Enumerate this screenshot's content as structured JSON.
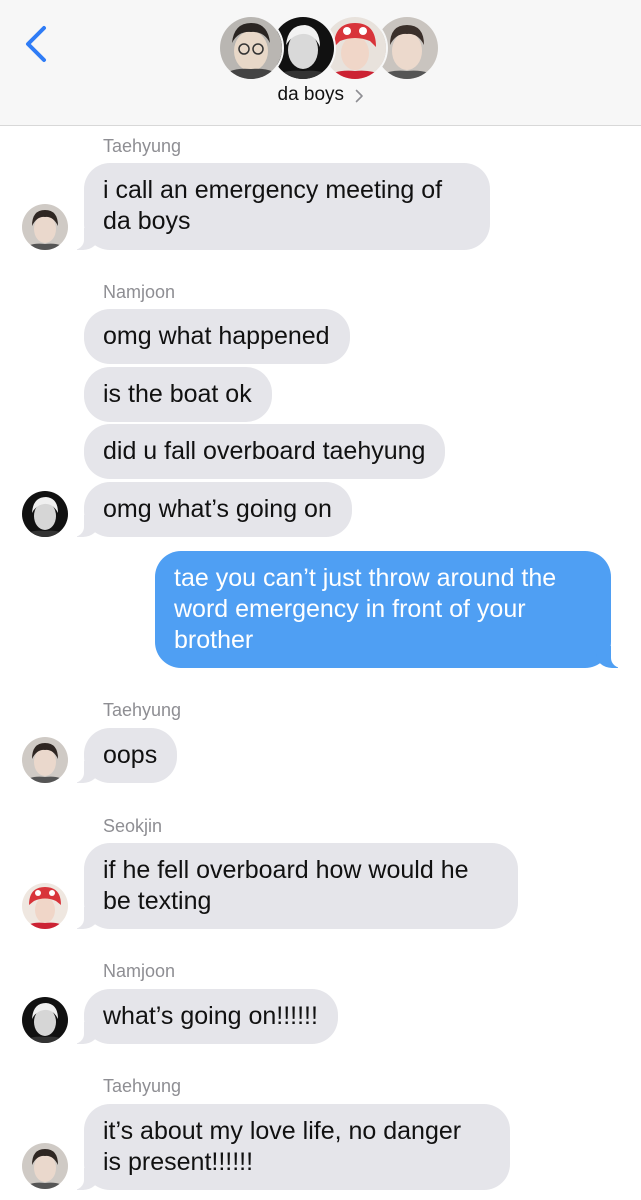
{
  "header": {
    "group_name": "da boys",
    "members": [
      "tae-photo",
      "joon-photo",
      "jin-photo",
      "jk-photo"
    ]
  },
  "messages": [
    {
      "sender": "Taehyung",
      "text_lines": [
        "i call an emergency meeting of",
        "da boys"
      ]
    },
    {
      "sender": "Namjoon",
      "texts": [
        "omg what happened",
        "is the boat ok",
        "did u fall overboard taehyung",
        "omg what’s going on"
      ]
    },
    {
      "sent_lines": [
        "tae you can’t just throw around the",
        "word emergency in front of your",
        "brother"
      ]
    },
    {
      "sender": "Taehyung",
      "text": "oops"
    },
    {
      "sender": "Seokjin",
      "text_lines": [
        "if he fell overboard how would he",
        "be texting"
      ]
    },
    {
      "sender": "Namjoon",
      "text": "what’s going on!!!!!!"
    },
    {
      "sender": "Taehyung",
      "text_lines": [
        "it’s about my love life, no danger",
        "is present!!!!!!"
      ]
    }
  ],
  "colors": {
    "incoming_bubble": "#e5e5ea",
    "outgoing_bubble": "#4f9ff3",
    "accent": "#2f7cf6",
    "sender_label": "#8e8e93"
  }
}
